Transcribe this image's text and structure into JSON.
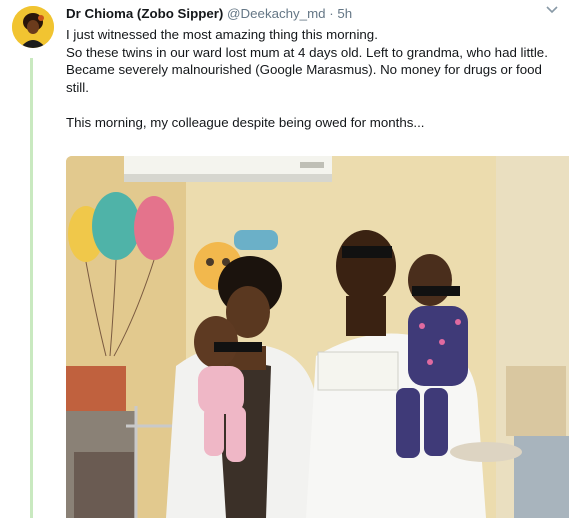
{
  "tweet": {
    "author_name": "Dr Chioma (Zobo Sipper)",
    "handle": "@Deekachy_md",
    "separator": "·",
    "timestamp": "5h",
    "lines": [
      "I just witnessed the most amazing thing this morning.",
      "So these twins in our ward lost mum at 4 days old. Left to grandma, who had little. Became severely malnourished (Google Marasmus). No money for drugs or food still.",
      "This morning, my colleague despite being owed for months..."
    ]
  },
  "icons": {
    "menu": "chevron-down-icon",
    "avatar": "profile-photo"
  },
  "colors": {
    "name": "#14171a",
    "muted": "#657786",
    "thread": "#c9e9c0",
    "wall": "#ecdcae"
  }
}
